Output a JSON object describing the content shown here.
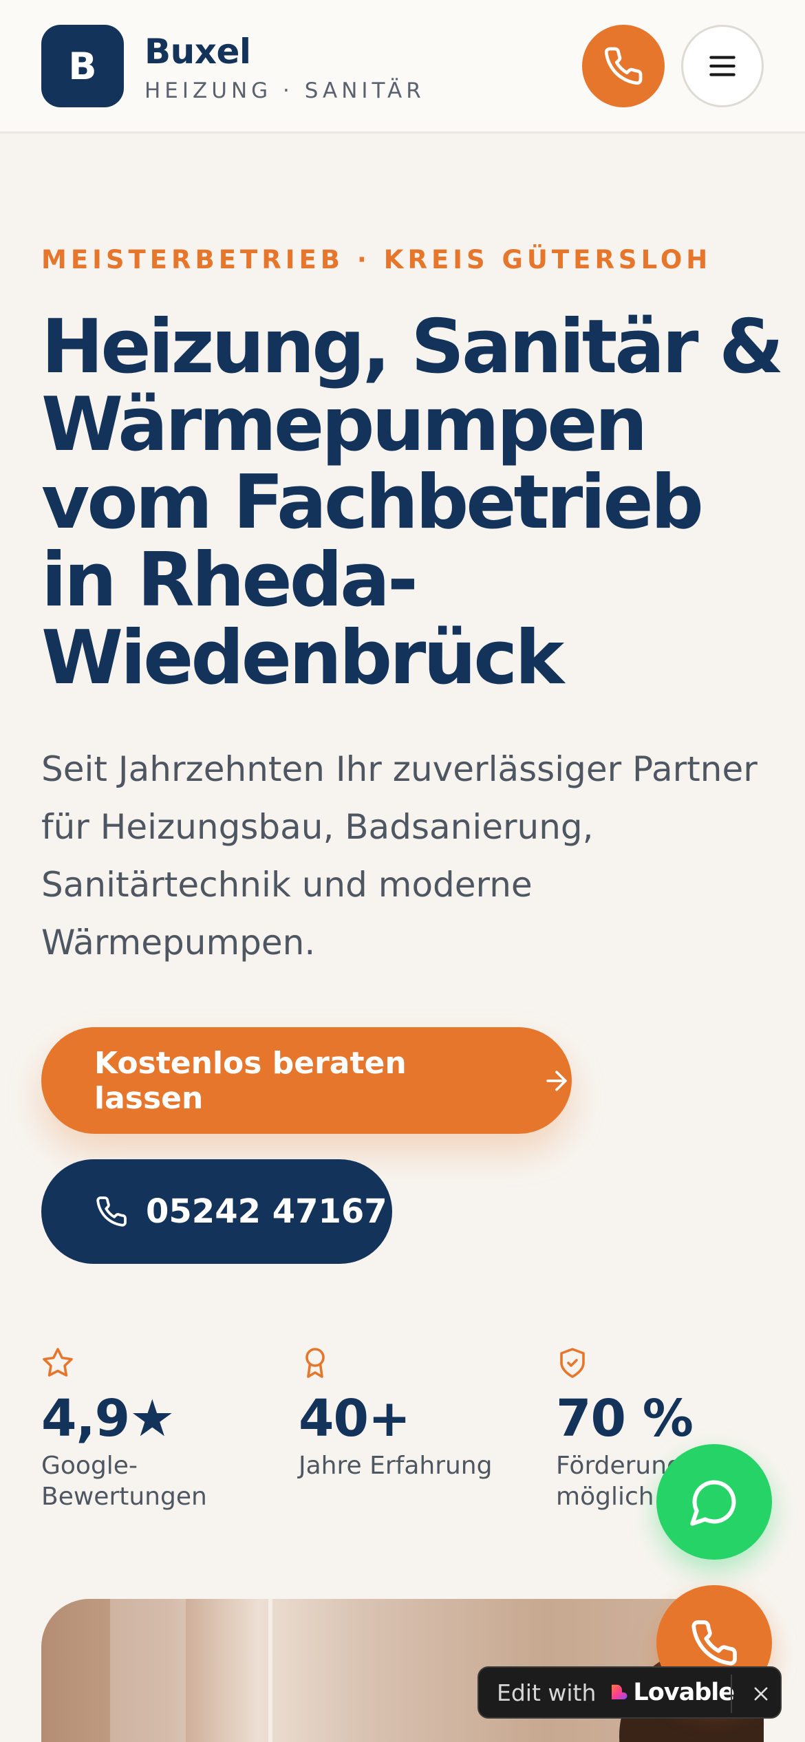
{
  "header": {
    "logo_letter": "B",
    "brand_name": "Buxel",
    "brand_tagline": "HEIZUNG · SANITÄR"
  },
  "hero": {
    "eyebrow": "MEISTERBETRIEB · KREIS GÜTERSLOH",
    "headline": "Heizung, Sanitär & Wärmepumpen vom Fachbetrieb in Rheda-Wiedenbrück",
    "lead": "Seit Jahrzehnten Ihr zuverlässiger Partner für Heizungsbau, Badsanierung, Sanitärtechnik und moderne Wärmepumpen.",
    "cta_primary": "Kostenlos beraten lassen",
    "cta_phone": "05242 47167"
  },
  "stats": [
    {
      "icon": "star-icon",
      "value": "4,9★",
      "label": "Google-Bewertungen"
    },
    {
      "icon": "award-icon",
      "value": "40+",
      "label": "Jahre Erfahrung"
    },
    {
      "icon": "shield-check-icon",
      "value": "70 %",
      "label": "Förderung möglich"
    }
  ],
  "badge": {
    "edit_text": "Edit with",
    "brand": "Lovable"
  },
  "colors": {
    "navy": "#13335a",
    "orange": "#e6762b",
    "whatsapp_green": "#25d366",
    "background": "#f7f4ef"
  }
}
